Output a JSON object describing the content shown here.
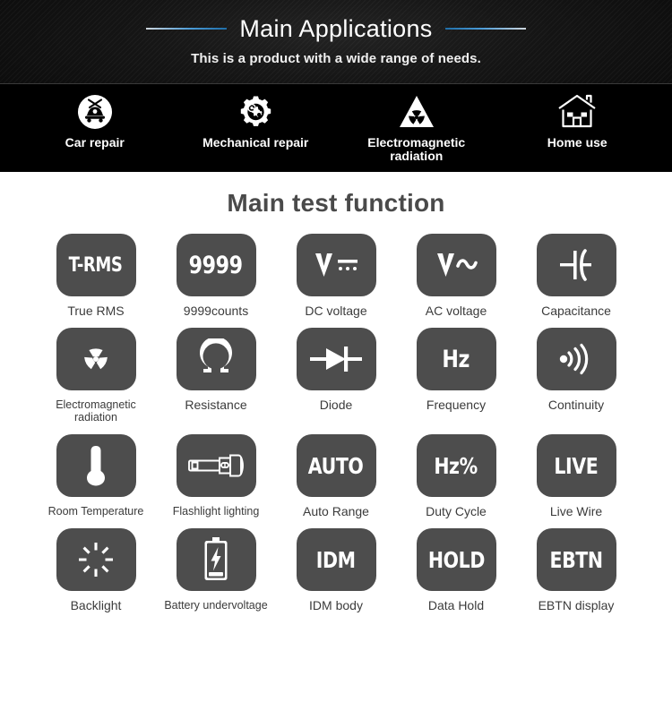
{
  "header": {
    "title": "Main Applications",
    "subtitle": "This is a product with a wide range of needs.",
    "accent_color": "#4b9cd8",
    "background_color": "#161616"
  },
  "applications": [
    {
      "label": "Car repair",
      "icon": "car-repair-icon"
    },
    {
      "label": "Mechanical repair",
      "icon": "gear-icon"
    },
    {
      "label": "Electromagnetic\nradiation",
      "icon": "radiation-triangle-icon"
    },
    {
      "label": "Home use",
      "icon": "house-icon"
    }
  ],
  "functions": {
    "section_title": "Main test function",
    "tile_color": "#4d4d4d",
    "tile_text_color": "#ffffff",
    "label_color": "#3b3b3b",
    "items": [
      {
        "glyph": "T-RMS",
        "label": "True RMS",
        "icon": "text-tile",
        "size": "sm"
      },
      {
        "glyph": "9999",
        "label": "9999counts",
        "icon": "text-tile",
        "size": "big"
      },
      {
        "glyph": "",
        "label": "DC voltage",
        "icon": "dc-voltage-icon",
        "size": "big"
      },
      {
        "glyph": "",
        "label": "AC voltage",
        "icon": "ac-voltage-icon",
        "size": "big"
      },
      {
        "glyph": "",
        "label": "Capacitance",
        "icon": "capacitor-icon",
        "size": "big"
      },
      {
        "glyph": "",
        "label": "Electromagnetic\nradiation",
        "icon": "radiation-icon",
        "size": "big"
      },
      {
        "glyph": "",
        "label": "Resistance",
        "icon": "ohm-icon",
        "size": "big"
      },
      {
        "glyph": "",
        "label": "Diode",
        "icon": "diode-icon",
        "size": "big"
      },
      {
        "glyph": "Hz",
        "label": "Frequency",
        "icon": "text-tile",
        "size": "big"
      },
      {
        "glyph": "",
        "label": "Continuity",
        "icon": "continuity-icon",
        "size": "big"
      },
      {
        "glyph": "",
        "label": "Room Temperature",
        "icon": "thermometer-icon",
        "size": "big"
      },
      {
        "glyph": "",
        "label": "Flashlight lighting",
        "icon": "flashlight-icon",
        "size": "big"
      },
      {
        "glyph": "AUTO",
        "label": "Auto Range",
        "icon": "text-tile",
        "size": "med"
      },
      {
        "glyph": "Hz%",
        "label": "Duty Cycle",
        "icon": "text-tile",
        "size": "med"
      },
      {
        "glyph": "LIVE",
        "label": "Live Wire",
        "icon": "text-tile",
        "size": "med"
      },
      {
        "glyph": "",
        "label": "Backlight",
        "icon": "backlight-icon",
        "size": "big"
      },
      {
        "glyph": "",
        "label": "Battery undervoltage",
        "icon": "battery-bolt-icon",
        "size": "big"
      },
      {
        "glyph": "IDM",
        "label": "IDM body",
        "icon": "text-tile",
        "size": "med"
      },
      {
        "glyph": "HOLD",
        "label": "Data Hold",
        "icon": "text-tile",
        "size": "med"
      },
      {
        "glyph": "EBTN",
        "label": "EBTN display",
        "icon": "text-tile",
        "size": "med"
      }
    ]
  }
}
